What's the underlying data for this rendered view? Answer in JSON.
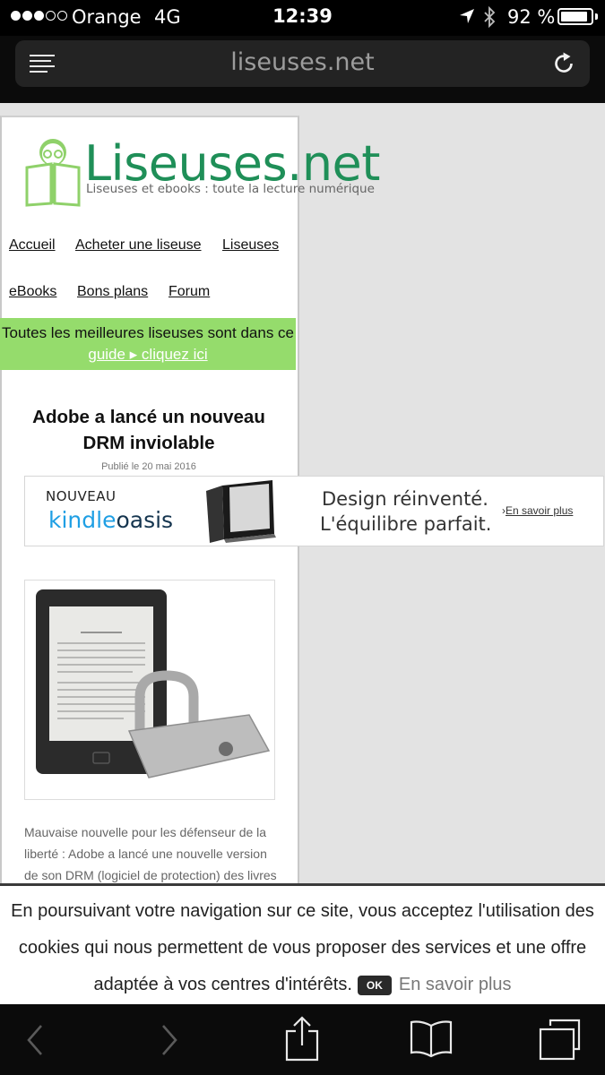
{
  "status": {
    "carrier": "Orange",
    "network": "4G",
    "time": "12:39",
    "battery_percent_label": "92 %",
    "battery_level": 0.92,
    "signal_bars_filled": 3,
    "signal_bars_total": 5
  },
  "browser": {
    "url": "liseuses.net"
  },
  "site": {
    "logo_title": "Liseuses.net",
    "tagline": "Liseuses et ebooks : toute la lecture numérique",
    "brand_color": "#1f8f58",
    "nav": {
      "accueil": "Accueil",
      "acheter": "Acheter une liseuse",
      "liseuses": "Liseuses",
      "ebooks": "eBooks",
      "bons_plans": "Bons plans",
      "forum": "Forum"
    },
    "promo": {
      "text": "Toutes les meilleures liseuses sont dans ce",
      "link": "guide ▸ cliquez ici",
      "color": "#95dc6c"
    }
  },
  "article": {
    "title_line1": "Adobe a lancé un nouveau",
    "title_line2": "DRM inviolable",
    "date": "Publié le 20 mai 2016",
    "body": [
      "Mauvaise nouvelle pour les défenseur de la",
      "liberté : Adobe a lancé une nouvelle version",
      "de son DRM (logiciel de protection) des livres"
    ]
  },
  "ad": {
    "nouveau": "NOUVEAU",
    "brand_kindle": "kindle",
    "brand_oasis": "oasis",
    "line1": "Design réinventé.",
    "line2": "L'équilibre parfait.",
    "more_arrow": "›",
    "more_link": "En savoir plus"
  },
  "cookie": {
    "line1": "En poursuivant votre navigation sur ce site, vous acceptez l'utilisation des",
    "line2": "cookies qui nous permettent de vous proposer des services et une offre",
    "line3": "adaptée à vos centres d'intérêts.",
    "ok_label": "OK",
    "more_label": "En savoir plus"
  }
}
